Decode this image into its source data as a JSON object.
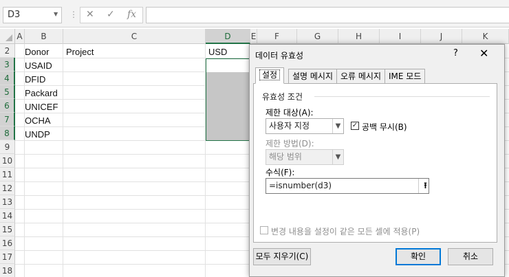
{
  "formula_bar": {
    "name_box": "D3",
    "cancel_icon": "✕",
    "enter_icon": "✓",
    "function_icon": "fx",
    "formula": ""
  },
  "columns": [
    "A",
    "B",
    "C",
    "D",
    "E",
    "F",
    "G",
    "H",
    "I",
    "J",
    "K"
  ],
  "rows": [
    "2",
    "3",
    "4",
    "5",
    "6",
    "7",
    "8",
    "9",
    "10",
    "11",
    "12",
    "13",
    "14",
    "15",
    "16",
    "17",
    "18"
  ],
  "cells": {
    "B2": "Donor",
    "C2": "Project",
    "D2": "USD",
    "B3": "USAID",
    "B4": "DFID",
    "B5": "Packard",
    "B6": "UNICEF",
    "B7": "OCHA",
    "B8": "UNDP"
  },
  "dialog": {
    "title": "데이터 유효성",
    "help": "?",
    "close": "✕",
    "tabs": [
      "설정",
      "설명 메시지",
      "오류 메시지",
      "IME 모드"
    ],
    "group_title": "유효성 조건",
    "allow_label": "제한 대상(A):",
    "allow_value": "사용자 지정",
    "ignore_blank_label": "공백 무시(B)",
    "ignore_blank_checked": true,
    "data_label": "제한 방법(D):",
    "data_value": "해당 범위",
    "formula_label": "수식(F):",
    "formula_value": "=isnumber(d3)",
    "apply_all_label": "변경 내용을 설정이 같은 모든 셀에 적용(P)",
    "apply_all_checked": false,
    "clear_all_button": "모두 지우기(C)",
    "ok_button": "확인",
    "cancel_button": "취소"
  },
  "colors": {
    "accent": "#217346",
    "default_button_border": "#0078d7"
  }
}
